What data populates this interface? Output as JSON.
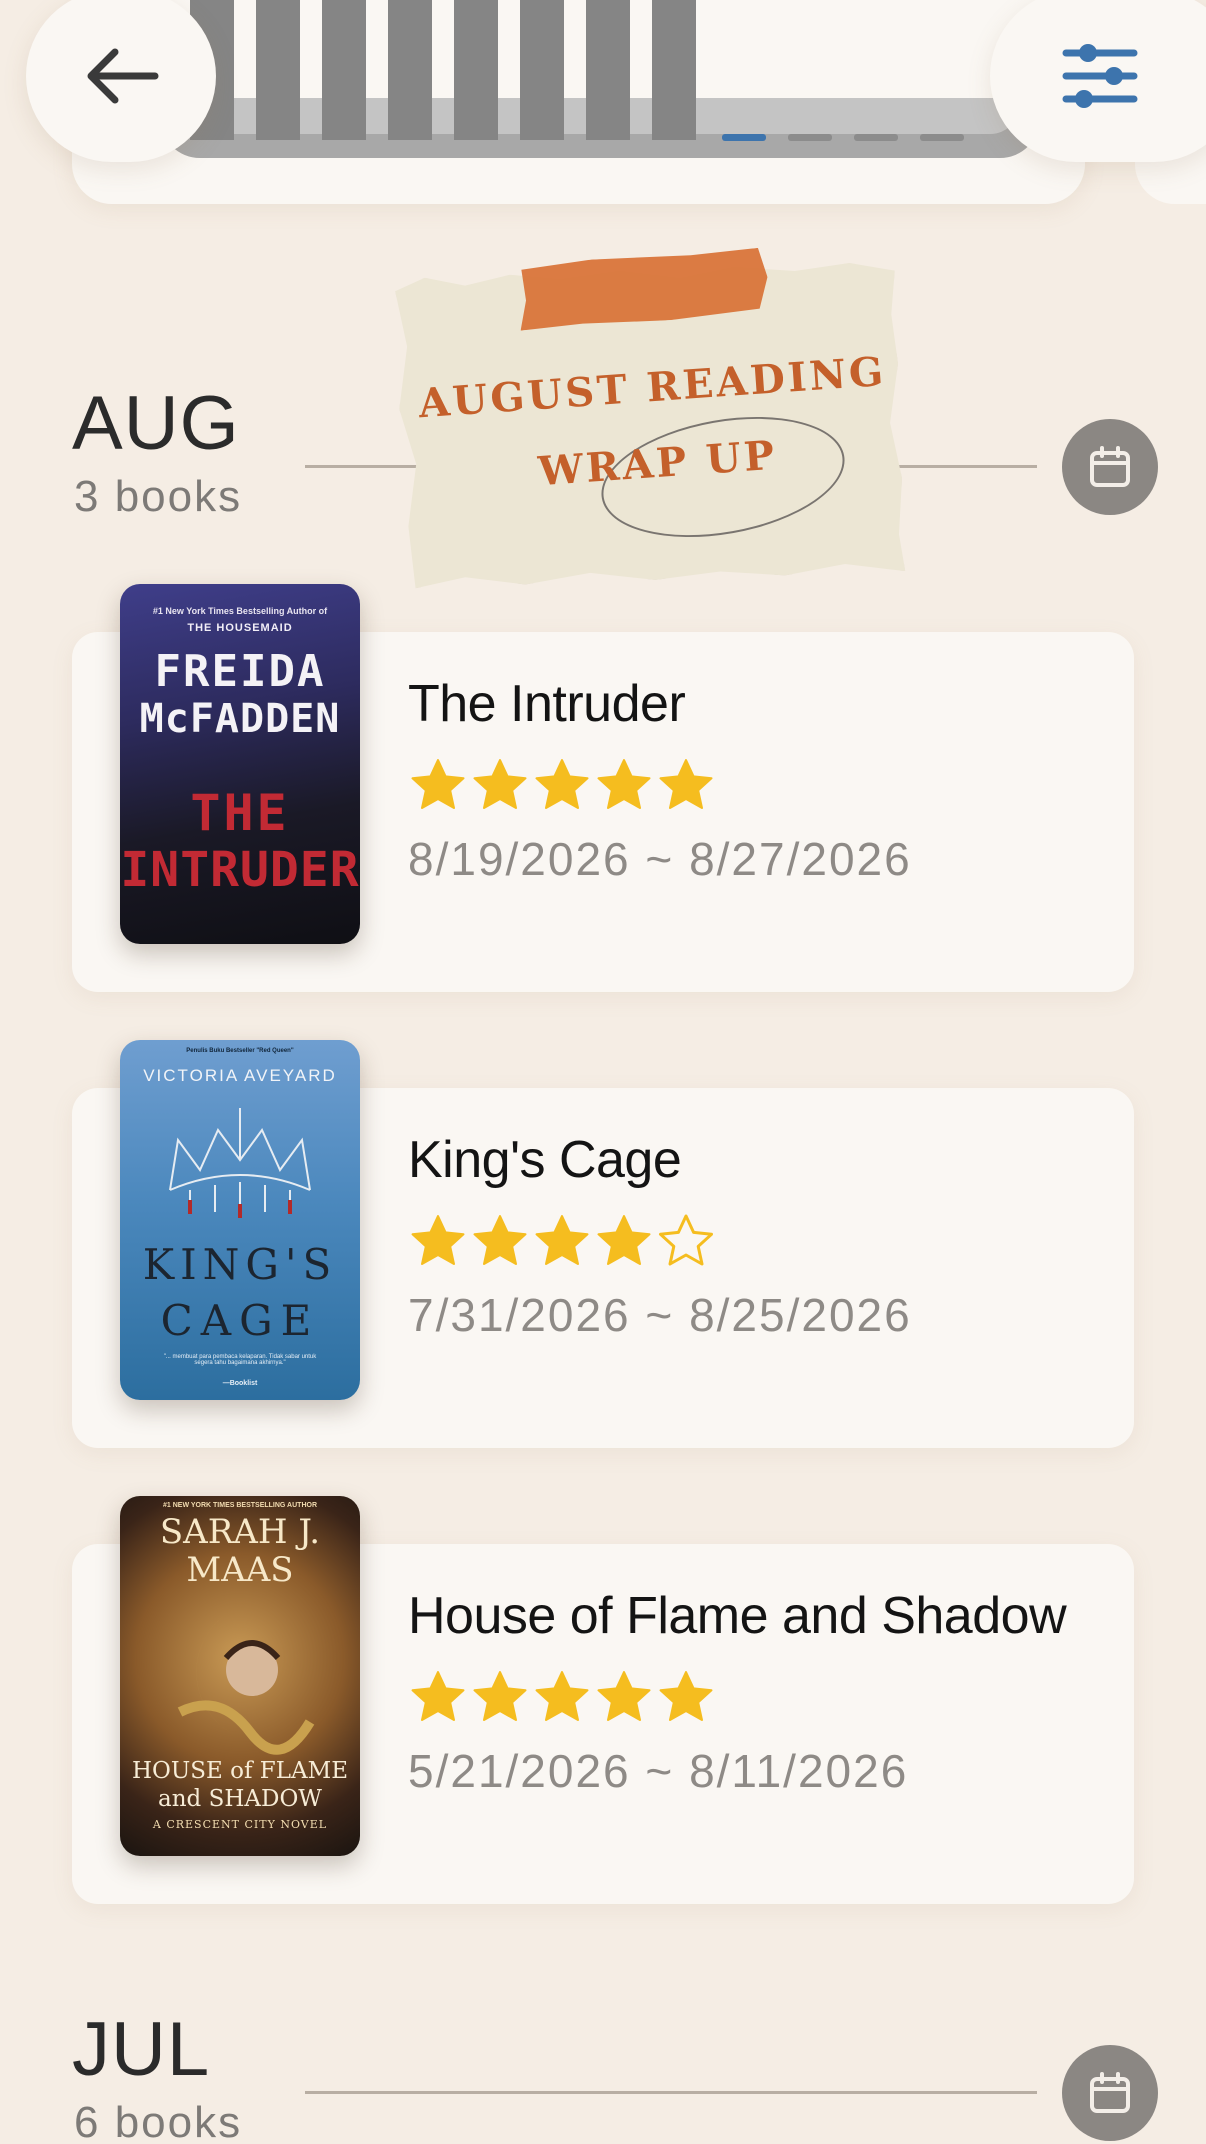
{
  "header": {
    "back_icon": "arrow-left-icon",
    "filter_icon": "sliders-icon"
  },
  "stats_strip": {
    "bar_count": 8,
    "page_dots": 4,
    "active_dot": 0
  },
  "months": [
    {
      "name": "AUG",
      "count": "3 books",
      "note": {
        "line1": "AUGUST READING",
        "line2": "WRAP UP"
      },
      "books": [
        {
          "title": "The Intruder",
          "rating": 5,
          "dates": "8/19/2026 ~ 8/27/2026",
          "cover": {
            "top_line": "#1 New York Times Bestselling Author of",
            "top_line2": "THE HOUSEMAID",
            "author1": "FREIDA",
            "author2": "McFADDEN",
            "title1": "THE",
            "title2": "INTRUDER"
          }
        },
        {
          "title": "King's Cage",
          "rating": 4,
          "dates": "7/31/2026 ~ 8/25/2026",
          "cover": {
            "top_line": "Penulis Buku Bestseller \"Red Queen\"",
            "author": "VICTORIA AVEYARD",
            "title1": "KING'S",
            "title2": "CAGE",
            "quote": "\"... membuat para pembaca kelaparan. Tidak sabar untuk segera tahu bagaimana akhirnya.\"",
            "quote_source": "—Booklist"
          }
        },
        {
          "title": "House of Flame and Shadow",
          "rating": 5,
          "dates": "5/21/2026 ~ 8/11/2026",
          "cover": {
            "top_line": "#1 NEW YORK TIMES BESTSELLING AUTHOR",
            "author1": "SARAH J.",
            "author2": "MAAS",
            "title1": "HOUSE of FLAME",
            "title2": "and SHADOW",
            "subtitle": "A CRESCENT CITY NOVEL"
          }
        }
      ]
    },
    {
      "name": "JUL",
      "count": "6 books"
    }
  ],
  "colors": {
    "background": "#f5ede4",
    "card": "#faf7f3",
    "star": "#f5bd1f",
    "note_text": "#c4602b",
    "tape": "#d9753a",
    "active_dot": "#3d74ad",
    "icon_blue": "#3d74ad"
  }
}
